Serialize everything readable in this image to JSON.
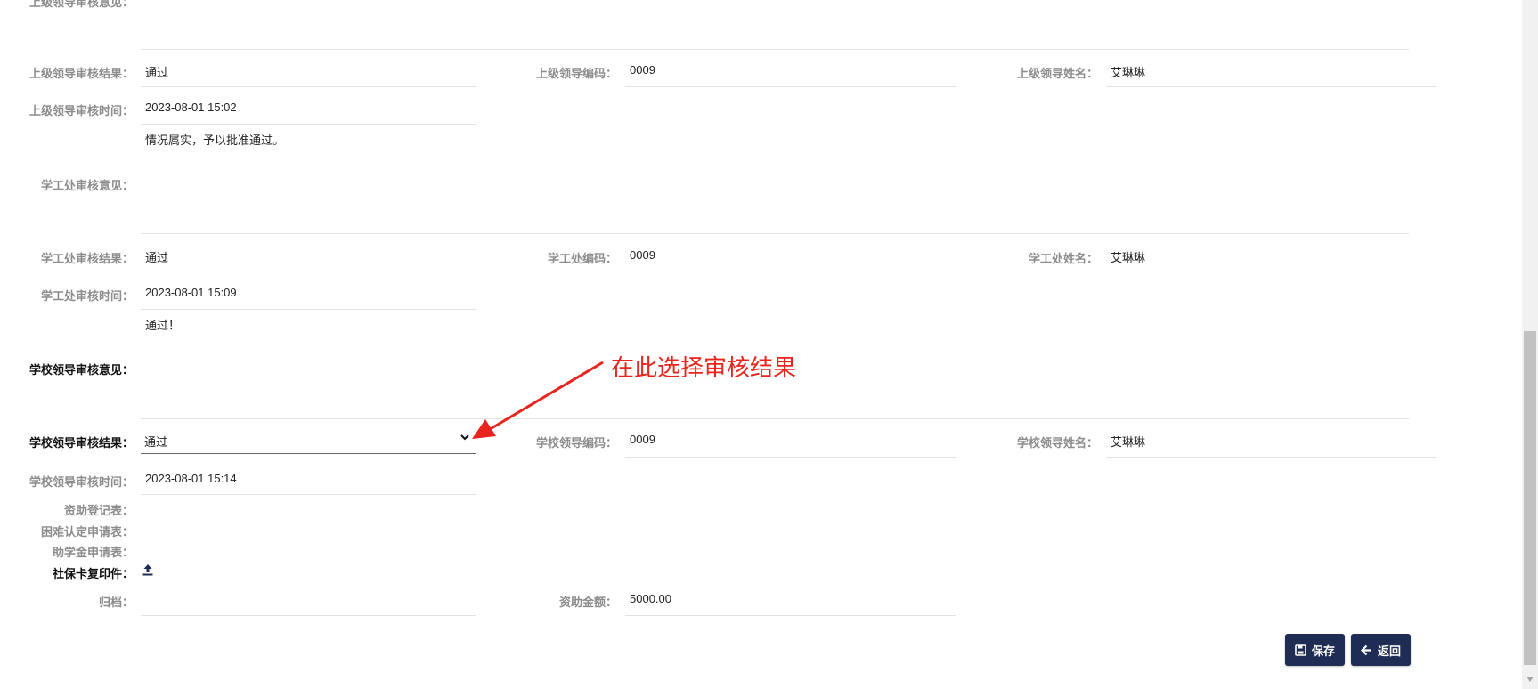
{
  "rows": {
    "top_cut_label": "上级领导审核意见：",
    "leader_result_label": "上级领导审核结果：",
    "leader_result_value": "通过",
    "leader_code_label": "上级领导编码：",
    "leader_code_value": "0009",
    "leader_name_label": "上级领导姓名：",
    "leader_name_value": "艾琳琳",
    "leader_time_label": "上级领导审核时间：",
    "leader_time_value": "2023-08-01 15:02",
    "leader_opinion_text": "情况属实，予以批准通过。",
    "xgc_opinion_label": "学工处审核意见：",
    "xgc_result_label": "学工处审核结果：",
    "xgc_result_value": "通过",
    "xgc_code_label": "学工处编码：",
    "xgc_code_value": "0009",
    "xgc_name_label": "学工处姓名：",
    "xgc_name_value": "艾琳琳",
    "xgc_time_label": "学工处审核时间：",
    "xgc_time_value": "2023-08-01 15:09",
    "xgc_opinion_text": "通过！",
    "school_opinion_label": "学校领导审核意见：",
    "school_result_label": "学校领导审核结果：",
    "school_result_value": "通过",
    "school_code_label": "学校领导编码：",
    "school_code_value": "0009",
    "school_name_label": "学校领导姓名：",
    "school_name_value": "艾琳琳",
    "school_time_label": "学校领导审核时间：",
    "school_time_value": "2023-08-01 15:14",
    "aid_form_label": "资助登记表：",
    "hardship_form_label": "困难认定申请表：",
    "grant_form_label": "助学金申请表：",
    "social_card_label": "社保卡复印件：",
    "archive_label": "归档：",
    "amount_label": "资助金额：",
    "amount_value": "5000.00"
  },
  "annotation": {
    "text": "在此选择审核结果",
    "color": "#e8241c"
  },
  "buttons": {
    "save_label": "保存",
    "back_label": "返回"
  },
  "icons": {
    "select": "chevron-down-icon",
    "upload": "upload-icon",
    "save": "save-icon",
    "back": "arrow-left-icon"
  },
  "colors": {
    "button_bg": "#1f2d55",
    "annotation": "#e8241c"
  }
}
